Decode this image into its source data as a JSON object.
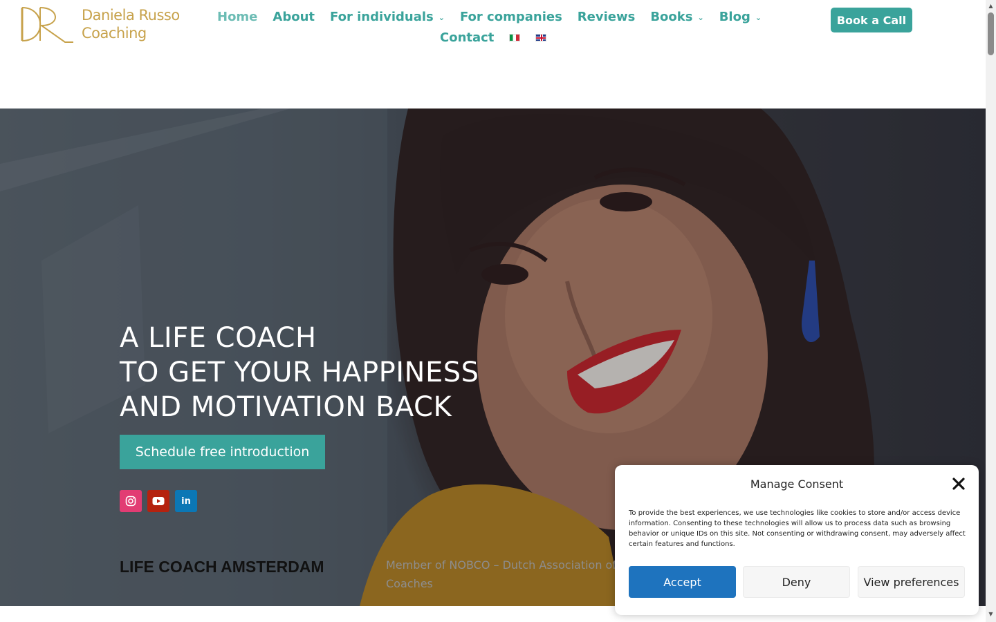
{
  "brand": {
    "name_line1": "Daniela Russo",
    "name_line2": "Coaching",
    "logo_color": "#c7a24b"
  },
  "nav": {
    "items": [
      {
        "label": "Home",
        "active": true
      },
      {
        "label": "About"
      },
      {
        "label": "For individuals",
        "dropdown": true
      },
      {
        "label": "For companies"
      },
      {
        "label": "Reviews"
      },
      {
        "label": "Books",
        "dropdown": true
      },
      {
        "label": "Blog",
        "dropdown": true
      }
    ],
    "contact": "Contact",
    "languages": [
      "it-flag-icon",
      "en-flag-icon"
    ],
    "accent": "#3aa39b"
  },
  "header_cta": "Book a Call",
  "hero": {
    "title_lines": [
      "A LIFE COACH",
      "TO GET YOUR HAPPINESS",
      "AND MOTIVATION BACK"
    ],
    "cta": "Schedule free introduction",
    "social": [
      "instagram-icon",
      "youtube-icon",
      "linkedin-icon"
    ],
    "subtitle": "LIFE COACH AMSTERDAM",
    "member_text": "Member of NOBCO – Dutch Association of Coaches"
  },
  "consent": {
    "title": "Manage Consent",
    "text": "To provide the best experiences, we use technologies like cookies to store and/or access device information. Consenting to these technologies will allow us to process data such as browsing behavior or unique IDs on this site. Not consenting or withdrawing consent, may adversely affect certain features and functions.",
    "accept": "Accept",
    "deny": "Deny",
    "preferences": "View preferences",
    "accept_color": "#1e73be"
  }
}
